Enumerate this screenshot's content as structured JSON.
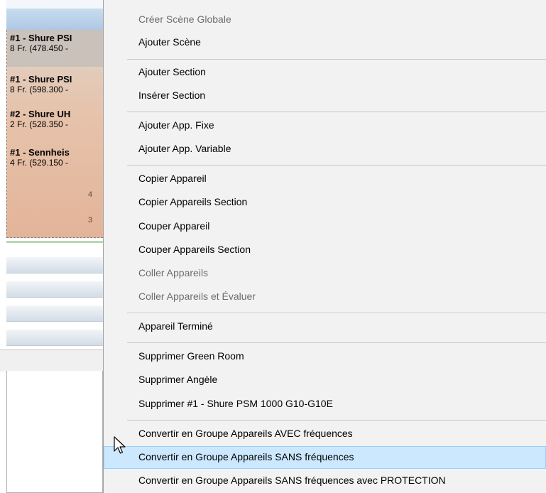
{
  "left_panel": {
    "devices": [
      {
        "name": "#1 - Shure PSI",
        "detail": "8 Fr.  (478.450 -"
      },
      {
        "name": "#1 - Shure PSI",
        "detail": "8 Fr.  (598.300 -"
      },
      {
        "name": "#2 - Shure UH",
        "detail": "2 Fr.  (528.350 -"
      },
      {
        "name": "#1 - Sennheis",
        "detail": "4 Fr.  (529.150 -"
      }
    ],
    "mark_4": "4",
    "mark_3": "3"
  },
  "context_menu": {
    "items": [
      {
        "label": "Créer Scène Globale",
        "enabled": false
      },
      {
        "label": "Ajouter Scène",
        "enabled": true
      },
      {
        "label": "Ajouter Section",
        "enabled": true
      },
      {
        "label": "Insérer Section",
        "enabled": true
      },
      {
        "label": "Ajouter App. Fixe",
        "enabled": true
      },
      {
        "label": "Ajouter App. Variable",
        "enabled": true
      },
      {
        "label": "Copier Appareil",
        "enabled": true
      },
      {
        "label": "Copier Appareils Section",
        "enabled": true
      },
      {
        "label": "Couper Appareil",
        "enabled": true
      },
      {
        "label": "Couper Appareils Section",
        "enabled": true
      },
      {
        "label": "Coller Appareils",
        "enabled": false
      },
      {
        "label": "Coller Appareils et Évaluer",
        "enabled": false
      },
      {
        "label": "Appareil Terminé",
        "enabled": true
      },
      {
        "label": "Supprimer  Green Room",
        "enabled": true
      },
      {
        "label": "Supprimer  Angèle",
        "enabled": true
      },
      {
        "label": "Supprimer  #1 - Shure PSM 1000 G10-G10E",
        "enabled": true
      },
      {
        "label": "Convertir en Groupe Appareils AVEC fréquences",
        "enabled": true
      },
      {
        "label": "Convertir en Groupe Appareils SANS fréquences",
        "enabled": true,
        "highlighted": true
      },
      {
        "label": "Convertir en Groupe Appareils SANS fréquences avec PROTECTION",
        "enabled": true
      }
    ]
  },
  "colors": {
    "menu_background": "#f2f2f2",
    "highlight": "#cce8ff",
    "disabled_text": "#6d6d6d"
  },
  "icons": [
    "mouse-pointer-icon"
  ]
}
